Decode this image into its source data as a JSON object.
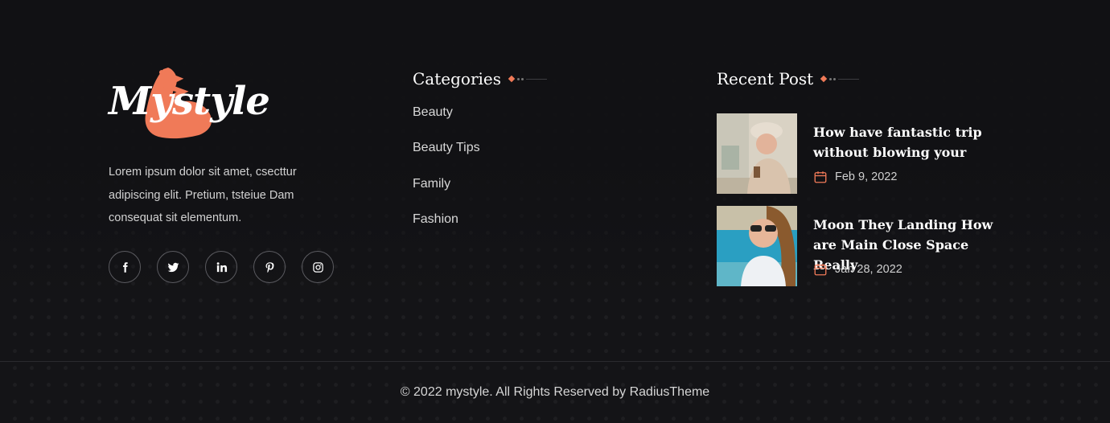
{
  "brand": {
    "logo_text": "Mystyle",
    "description": "Lorem ipsum dolor sit amet, csecttur adipiscing elit. Pretium, tsteiue Dam consequat sit elementum.",
    "accent_color": "#f07a58",
    "social": [
      {
        "name": "facebook",
        "icon": "facebook-icon"
      },
      {
        "name": "twitter",
        "icon": "twitter-icon"
      },
      {
        "name": "linkedin",
        "icon": "linkedin-icon"
      },
      {
        "name": "pinterest",
        "icon": "pinterest-icon"
      },
      {
        "name": "instagram",
        "icon": "instagram-icon"
      }
    ]
  },
  "categories": {
    "title": "Categories",
    "items": [
      "Beauty",
      "Beauty Tips",
      "Family",
      "Fashion"
    ]
  },
  "recent_posts": {
    "title": "Recent Post",
    "posts": [
      {
        "title": "How have fantastic trip without blowing your",
        "date": "Feb 9, 2022"
      },
      {
        "title": "Moon They Landing How are Main Close Space Really",
        "date": "Jan 28, 2022"
      }
    ]
  },
  "footer": {
    "copyright": "© 2022 mystyle. All Rights Reserved by RadiusTheme"
  }
}
